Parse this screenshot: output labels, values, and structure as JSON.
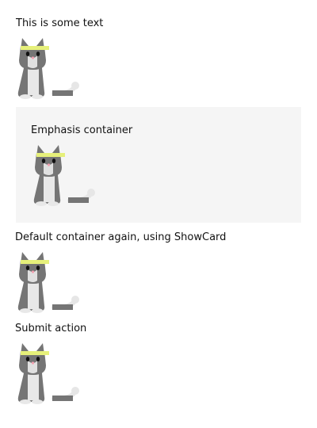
{
  "blocks": {
    "intro_text": "This is some text",
    "emphasis_text": "Emphasis container",
    "default_again_text": "Default container again, using ShowCard",
    "submit_text": "Submit action"
  },
  "images": {
    "cat_icon": "cat-with-yellow-headband-icon"
  },
  "colors": {
    "emphasis_background": "#f5f5f5",
    "cat_body": "#757575",
    "cat_light": "#e8e8e8",
    "headband": "#e6f07a",
    "nose": "#f2a0b0"
  }
}
